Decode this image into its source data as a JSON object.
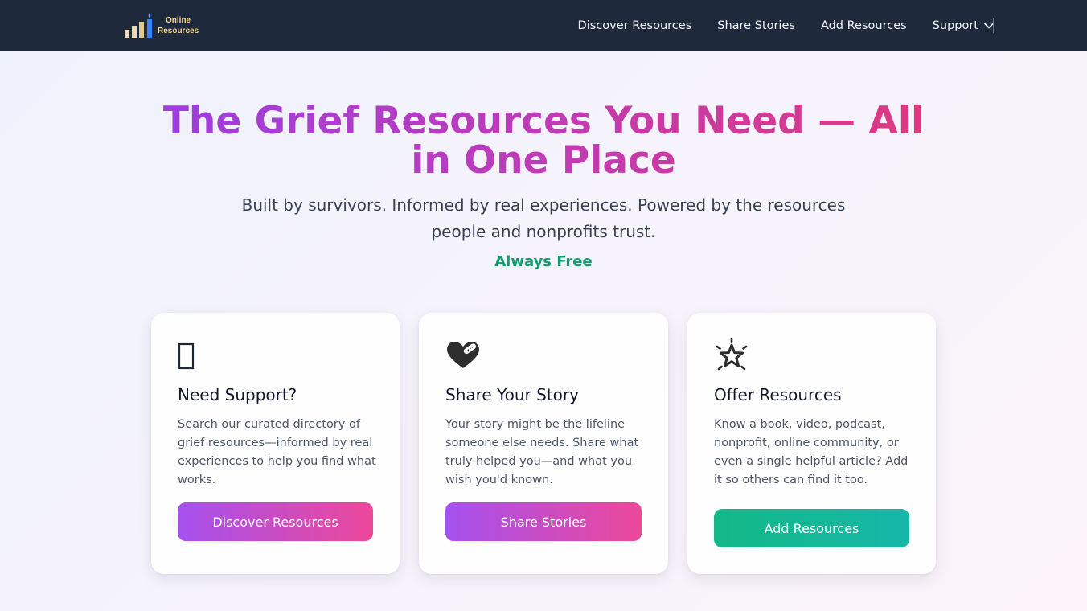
{
  "nav": {
    "logo": {
      "line1": "Online",
      "line2": "Resources",
      "icon": "bar-chart-candle-icon"
    },
    "links": [
      {
        "label": "Discover Resources"
      },
      {
        "label": "Share Stories"
      },
      {
        "label": "Add Resources"
      },
      {
        "label": "Support",
        "icon": "chevron-down-icon"
      }
    ]
  },
  "hero": {
    "title": "The Grief Resources You Need — All in One Place",
    "subtitle": "Built by survivors. Informed by real experiences. Powered by the resources people and nonprofits trust.",
    "tagline": "Always Free"
  },
  "cards": [
    {
      "icon": "missing-glyph-icon",
      "title": "Need Support?",
      "description": "Search our curated directory of grief resources—informed by real experiences to help you find what works.",
      "button": "Discover Resources"
    },
    {
      "icon": "heart-with-bandage-icon",
      "title": "Share Your Story",
      "description": "Your story might be the lifeline someone else needs. Share what truly helped you—and what you wish you'd known.",
      "button": "Share Stories"
    },
    {
      "icon": "shining-star-icon",
      "title": "Offer Resources",
      "description": "Know a book, video, podcast, nonprofit, online community, or even a single helpful article? Add it so others can find it too.",
      "button": "Add Resources"
    }
  ],
  "colors": {
    "nav_bg": "#1e293b",
    "title_gradient_start": "#9b3fe0",
    "title_gradient_end": "#e0397c",
    "free_green": "#0f9b6c",
    "button_purple_start": "#a551ef",
    "button_pink_end": "#ec4899",
    "button_green": "#14b886"
  }
}
